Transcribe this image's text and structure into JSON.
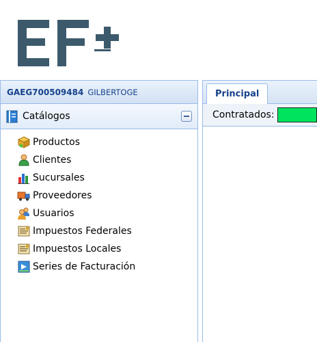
{
  "user": {
    "rfc": "GAEG700509484",
    "name": "GILBERTOGE"
  },
  "catalog": {
    "title": "Catálogos",
    "items": [
      {
        "label": "Productos",
        "icon": "box-icon"
      },
      {
        "label": "Clientes",
        "icon": "person-icon"
      },
      {
        "label": "Sucursales",
        "icon": "bar-chart-icon"
      },
      {
        "label": "Proveedores",
        "icon": "truck-icon"
      },
      {
        "label": "Usuarios",
        "icon": "users-icon"
      },
      {
        "label": "Impuestos Federales",
        "icon": "tax-icon"
      },
      {
        "label": "Impuestos Locales",
        "icon": "tax-icon"
      },
      {
        "label": "Series de Facturación",
        "icon": "invoice-series-icon"
      }
    ]
  },
  "tabs": [
    {
      "label": "Principal",
      "active": true
    }
  ],
  "status": {
    "contracted_label": "Contratados:",
    "contracted_color": "#00e35e"
  },
  "colors": {
    "logo": "#3c5a6c",
    "border": "#99bbe8",
    "header_text": "#15428b"
  }
}
